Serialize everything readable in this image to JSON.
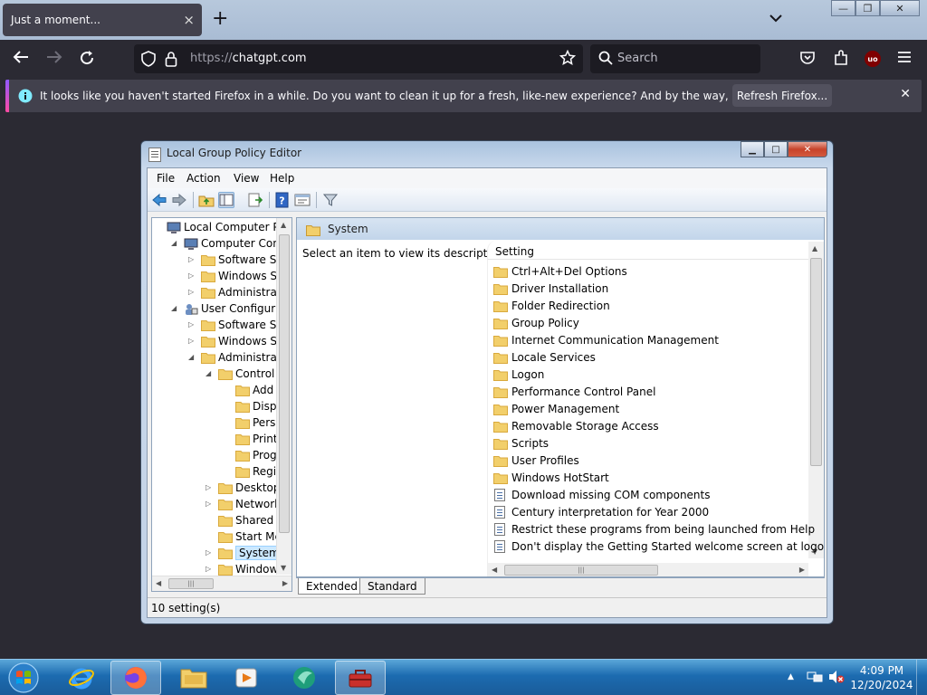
{
  "browser": {
    "tab_title": "Just a moment...",
    "tab_close": "×",
    "new_tab": "+",
    "url_protocol": "https://",
    "url_host": "chatgpt.com",
    "search_placeholder": "Search",
    "notice_message": "It looks like you haven't started Firefox in a while. Do you want to clean it up for a fresh, like-new experience? And by the way, welcome back!",
    "notice_button": "Refresh Firefox...",
    "notice_close": "✕",
    "account_badge": "uo"
  },
  "window": {
    "title": "Local Group Policy Editor",
    "menu": [
      "File",
      "Action",
      "View",
      "Help"
    ],
    "tree": [
      {
        "label": "Local Computer Polic",
        "indent": 0,
        "arrow": "",
        "icon": "computer"
      },
      {
        "label": "Computer Config",
        "indent": 1,
        "arrow": "◢",
        "icon": "computer"
      },
      {
        "label": "Software Setti",
        "indent": 2,
        "arrow": "▷",
        "icon": "folder"
      },
      {
        "label": "Windows Sett",
        "indent": 2,
        "arrow": "▷",
        "icon": "folder"
      },
      {
        "label": "Administrative",
        "indent": 2,
        "arrow": "▷",
        "icon": "folder"
      },
      {
        "label": "User Configuratio",
        "indent": 1,
        "arrow": "◢",
        "icon": "user"
      },
      {
        "label": "Software Setti",
        "indent": 2,
        "arrow": "▷",
        "icon": "folder"
      },
      {
        "label": "Windows Sett",
        "indent": 2,
        "arrow": "▷",
        "icon": "folder"
      },
      {
        "label": "Administrative",
        "indent": 2,
        "arrow": "◢",
        "icon": "folder"
      },
      {
        "label": "Control Pa",
        "indent": 3,
        "arrow": "◢",
        "icon": "folder"
      },
      {
        "label": "Add or",
        "indent": 4,
        "arrow": "",
        "icon": "folder"
      },
      {
        "label": "Display",
        "indent": 4,
        "arrow": "",
        "icon": "folder"
      },
      {
        "label": "Person",
        "indent": 4,
        "arrow": "",
        "icon": "folder"
      },
      {
        "label": "Printer",
        "indent": 4,
        "arrow": "",
        "icon": "folder"
      },
      {
        "label": "Progra",
        "indent": 4,
        "arrow": "",
        "icon": "folder"
      },
      {
        "label": "Regior",
        "indent": 4,
        "arrow": "",
        "icon": "folder"
      },
      {
        "label": "Desktop",
        "indent": 3,
        "arrow": "▷",
        "icon": "folder"
      },
      {
        "label": "Network",
        "indent": 3,
        "arrow": "▷",
        "icon": "folder"
      },
      {
        "label": "Shared Fol",
        "indent": 3,
        "arrow": "",
        "icon": "folder"
      },
      {
        "label": "Start Menu",
        "indent": 3,
        "arrow": "",
        "icon": "folder"
      },
      {
        "label": "System",
        "indent": 3,
        "arrow": "▷",
        "icon": "folder",
        "selected": true
      },
      {
        "label": "Windows C",
        "indent": 3,
        "arrow": "▷",
        "icon": "folder"
      }
    ],
    "pane_title": "System",
    "description": "Select an item to view its description.",
    "column_header": "Setting",
    "items": [
      {
        "label": "Ctrl+Alt+Del Options",
        "type": "folder"
      },
      {
        "label": "Driver Installation",
        "type": "folder"
      },
      {
        "label": "Folder Redirection",
        "type": "folder"
      },
      {
        "label": "Group Policy",
        "type": "folder"
      },
      {
        "label": "Internet Communication Management",
        "type": "folder"
      },
      {
        "label": "Locale Services",
        "type": "folder"
      },
      {
        "label": "Logon",
        "type": "folder"
      },
      {
        "label": "Performance Control Panel",
        "type": "folder"
      },
      {
        "label": "Power Management",
        "type": "folder"
      },
      {
        "label": "Removable Storage Access",
        "type": "folder"
      },
      {
        "label": "Scripts",
        "type": "folder"
      },
      {
        "label": "User Profiles",
        "type": "folder"
      },
      {
        "label": "Windows HotStart",
        "type": "folder"
      },
      {
        "label": "Download missing COM components",
        "type": "policy"
      },
      {
        "label": "Century interpretation for Year 2000",
        "type": "policy"
      },
      {
        "label": "Restrict these programs from being launched from Help",
        "type": "policy"
      },
      {
        "label": "Don't display the Getting Started welcome screen at logon",
        "type": "policy"
      }
    ],
    "tabs": [
      "Extended",
      "Standard"
    ],
    "status": "10 setting(s)"
  },
  "taskbar": {
    "time": "4:09 PM",
    "date": "12/20/2024"
  },
  "colors": {
    "folder": "#f2cf6b",
    "folder_dark": "#d9a93c",
    "accent": "#1a5c99"
  }
}
